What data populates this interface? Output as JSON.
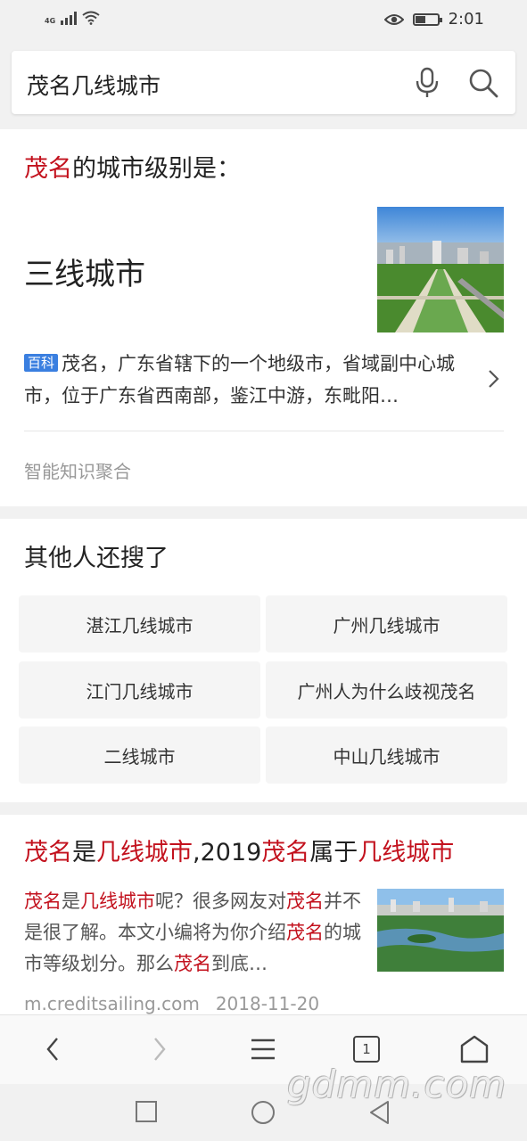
{
  "status_bar": {
    "network": "4G",
    "time": "2:01",
    "battery_percent": 45
  },
  "search": {
    "query": "茂名几线城市"
  },
  "answer": {
    "question_highlight": "茂名",
    "question_rest": "的城市级别是：",
    "answer_text": "三线城市",
    "baike_badge": "百科",
    "baike_text": "茂名，广东省辖下的一个地级市，省域副中心城市，位于广东省西南部，鉴江中游，东毗阳…",
    "source_label": "智能知识聚合"
  },
  "others": {
    "title": "其他人还搜了",
    "tags": [
      "湛江几线城市",
      "广州几线城市",
      "江门几线城市",
      "广州人为什么歧视茂名",
      "二线城市",
      "中山几线城市"
    ]
  },
  "result": {
    "title_parts": [
      {
        "t": "茂名",
        "hl": true
      },
      {
        "t": "是",
        "hl": false
      },
      {
        "t": "几线城市",
        "hl": true
      },
      {
        "t": ",2019",
        "hl": false
      },
      {
        "t": "茂名",
        "hl": true
      },
      {
        "t": "属于",
        "hl": false
      },
      {
        "t": "几线城市",
        "hl": true
      }
    ],
    "snippet_parts": [
      {
        "t": "茂名",
        "hl": true
      },
      {
        "t": "是",
        "hl": false
      },
      {
        "t": "几线城市",
        "hl": true
      },
      {
        "t": "呢？很多网友对",
        "hl": false
      },
      {
        "t": "茂名",
        "hl": true
      },
      {
        "t": "并不是很了解。本文小编将为你介绍",
        "hl": false
      },
      {
        "t": "茂名",
        "hl": true
      },
      {
        "t": "的城市等级划分。那么",
        "hl": false
      },
      {
        "t": "茂名",
        "hl": true
      },
      {
        "t": "到底…",
        "hl": false
      }
    ],
    "source": "m.creditsailing.com",
    "date": "2018-11-20"
  },
  "browser_bar": {
    "tab_count": "1"
  },
  "watermark": "gdmm.com",
  "colors": {
    "highlight": "#c3121e",
    "badge": "#3a7fe0"
  }
}
